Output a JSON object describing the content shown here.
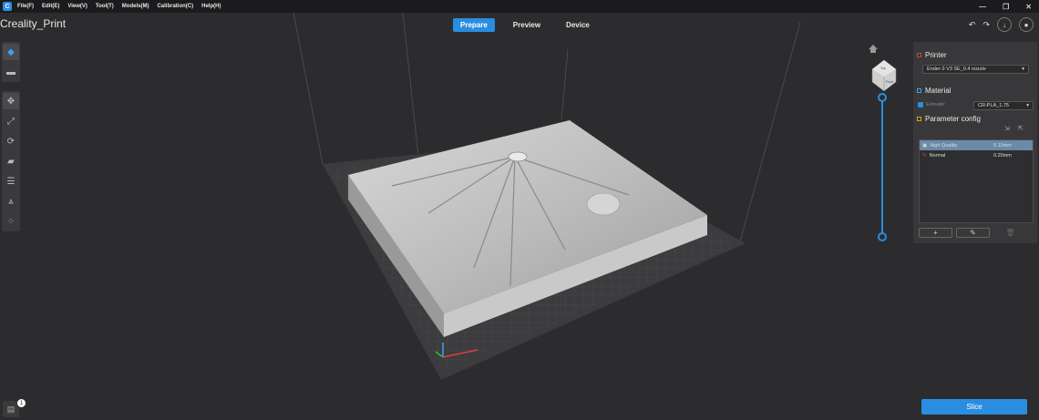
{
  "menubar": {
    "items": [
      "File(F)",
      "Edit(E)",
      "View(V)",
      "Tool(T)",
      "Models(M)",
      "Calibration(C)",
      "Help(H)"
    ],
    "window_controls": [
      "—",
      "❐",
      "✕"
    ]
  },
  "app": {
    "title": "Creality_Print"
  },
  "modes": [
    {
      "label": "Prepare",
      "active": true
    },
    {
      "label": "Preview",
      "active": false
    },
    {
      "label": "Device",
      "active": false
    }
  ],
  "top_right": {
    "undo": "↶",
    "redo": "↷",
    "download": "↓",
    "account": "●"
  },
  "left_toolbar": {
    "top_icons": [
      "cube-icon",
      "folder-icon"
    ],
    "tools": [
      "move-icon",
      "scale-icon",
      "rotate-icon",
      "lay-flat-icon",
      "arrange-icon",
      "support-icon",
      "multi-icon"
    ]
  },
  "view_cube": {
    "face_top": "Top",
    "face_front": "Front"
  },
  "right_panel": {
    "printer": {
      "title": "Printer",
      "selected": "Ender-3 V3 SE_0.4 nozzle"
    },
    "material": {
      "title": "Material",
      "extruder_label": "Extruder",
      "selected": "CR-PLA_1.75"
    },
    "param": {
      "title": "Parameter config",
      "rows": [
        {
          "name": "High Quality",
          "value": "0.10mm",
          "selected": true
        },
        {
          "name": "Normal",
          "value": "0.20mm",
          "selected": false
        }
      ],
      "buttons": [
        "+",
        "✎",
        "🗑"
      ]
    }
  },
  "slice": {
    "label": "Slice"
  },
  "notification": {
    "count": "1"
  },
  "colors": {
    "accent": "#2a8de0",
    "bg": "#2c2c2e",
    "panel": "#38383a"
  }
}
